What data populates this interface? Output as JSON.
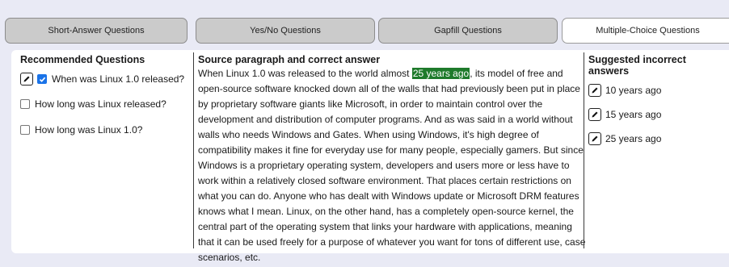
{
  "tabs": [
    {
      "label": "Short-Answer Questions"
    },
    {
      "label": "Yes/No Questions"
    },
    {
      "label": "Gapfill Questions"
    },
    {
      "label": "Multiple-Choice Questions"
    }
  ],
  "recommended": {
    "title": "Recommended Questions",
    "items": [
      {
        "label": "When was Linux 1.0 released?",
        "checked": true
      },
      {
        "label": "How long was Linux released?",
        "checked": false
      },
      {
        "label": "How long was Linux 1.0?",
        "checked": false
      }
    ]
  },
  "source": {
    "title": "Source paragraph and correct answer",
    "before": "When Linux 1.0 was released to the world almost ",
    "answer": "25 years ago",
    "after": ", its model of free and open-source software knocked down all of the walls that had previously been put in place by proprietary software giants like Microsoft, in order to maintain control over the development and distribution of computer programs. And as was said in a world without walls who needs Windows and Gates. When using Windows, it's high degree of compatibility makes it fine for everyday use for many people, especially gamers. But since Windows is a proprietary operating system, developers and users more or less have to work within a relatively closed software environment. That places certain restrictions on what you can do. Anyone who has dealt with Windows update or Microsoft DRM features knows what I mean. Linux, on the other hand, has a completely open-source kernel, the central part of the operating system that links your hardware with applications, meaning that it can be used freely for a purpose of whatever you want for tons of different use, case scenarios, etc."
  },
  "incorrect": {
    "title": "Suggested incorrect answers",
    "items": [
      {
        "label": "10 years ago"
      },
      {
        "label": "15 years ago"
      },
      {
        "label": "25 years ago"
      }
    ]
  },
  "colors": {
    "background": "#e9eaf5",
    "tab_inactive": "#cbcbcb",
    "tab_active": "#ffffff",
    "highlight": "#1e7a2b",
    "checkbox_checked": "#1a73e8"
  },
  "icons": {
    "edit": "pencil-icon",
    "check": "checkmark-icon"
  }
}
